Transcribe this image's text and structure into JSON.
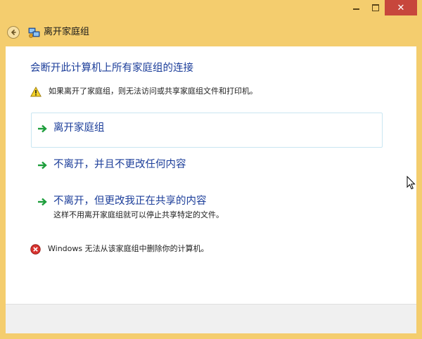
{
  "window": {
    "controls": {
      "minimize_icon": "minimize-icon",
      "maximize_icon": "maximize-icon",
      "close_icon": "close-icon",
      "close_glyph": "✕"
    }
  },
  "nav": {
    "title": "离开家庭组",
    "back_icon": "back-arrow-icon",
    "homegroup_icon": "homegroup-icon"
  },
  "content": {
    "heading": "会断开此计算机上所有家庭组的连接",
    "warning": {
      "icon": "warning-icon",
      "text": "如果离开了家庭组，则无法访问或共享家庭组文件和打印机。"
    },
    "options": [
      {
        "label": "离开家庭组",
        "description": ""
      },
      {
        "label": "不离开，并且不更改任何内容",
        "description": ""
      },
      {
        "label": "不离开，但更改我正在共享的内容",
        "description": "这样不用离开家庭组就可以停止共享特定的文件。"
      }
    ],
    "error": {
      "icon": "error-icon",
      "text": "Windows 无法从该家庭组中删除你的计算机。"
    }
  },
  "colors": {
    "frame": "#f4cd6e",
    "link_blue": "#1c3e9a",
    "arrow_green": "#1e9e3c",
    "close_red": "#c7463c",
    "hover_border": "#c9e6f2"
  }
}
